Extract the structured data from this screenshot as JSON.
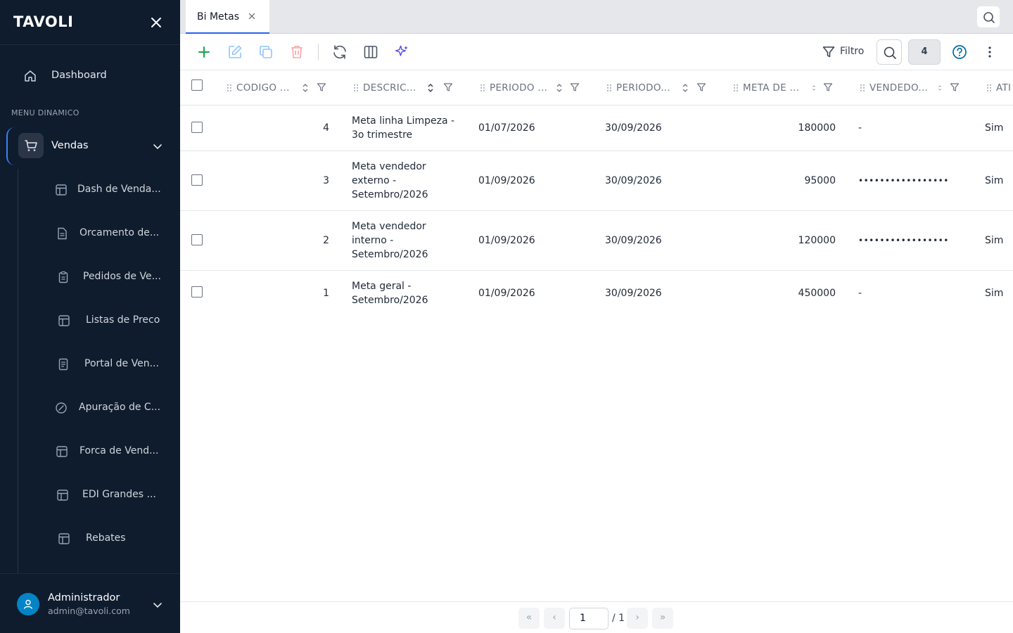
{
  "app": {
    "logo": "TAVOLI"
  },
  "sidebar": {
    "dashboard_label": "Dashboard",
    "section_title": "MENU DINAMICO",
    "vendas_label": "Vendas",
    "submenu": [
      {
        "label": "Dash de Venda...",
        "icon": "dashboard-icon"
      },
      {
        "label": "Orcamento de...",
        "icon": "document-icon"
      },
      {
        "label": "Pedidos de Ve...",
        "icon": "clipboard-icon"
      },
      {
        "label": "Listas de Preco",
        "icon": "layout-icon"
      },
      {
        "label": "Portal de Ven...",
        "icon": "document-icon"
      },
      {
        "label": "Apuração de C...",
        "icon": "gauge-icon"
      },
      {
        "label": "Forca de Vend...",
        "icon": "layout-icon"
      },
      {
        "label": "EDI Grandes ...",
        "icon": "layout-icon"
      },
      {
        "label": "Rebates",
        "icon": "layout-icon"
      }
    ],
    "user": {
      "name": "Administrador",
      "email": "admin@tavoli.com"
    }
  },
  "tabs": [
    {
      "label": "Bi Metas",
      "active": true
    }
  ],
  "toolbar": {
    "filter_label": "Filtro",
    "record_count": "4"
  },
  "table": {
    "columns": [
      "CODIGO ...",
      "DESCRIC...",
      "PERIODO ...",
      "PERIODO...",
      "META DE ...",
      "VENDEDO...",
      "ATI"
    ],
    "rows": [
      {
        "codigo": "4",
        "descricao": "Meta linha Limpeza - 3o trimestre",
        "inicio": "01/07/2026",
        "fim": "30/09/2026",
        "meta": "180000",
        "vendedor": "-",
        "ativo": "Sim"
      },
      {
        "codigo": "3",
        "descricao": "Meta vendedor externo - Setembro/2026",
        "inicio": "01/09/2026",
        "fim": "30/09/2026",
        "meta": "95000",
        "vendedor": "•••••••••••••••••",
        "ativo": "Sim"
      },
      {
        "codigo": "2",
        "descricao": "Meta vendedor interno - Setembro/2026",
        "inicio": "01/09/2026",
        "fim": "30/09/2026",
        "meta": "120000",
        "vendedor": "•••••••••••••••••",
        "ativo": "Sim"
      },
      {
        "codigo": "1",
        "descricao": "Meta geral - Setembro/2026",
        "inicio": "01/09/2026",
        "fim": "30/09/2026",
        "meta": "450000",
        "vendedor": "-",
        "ativo": "Sim"
      }
    ]
  },
  "pagination": {
    "first": "«",
    "prev": "‹",
    "next": "›",
    "last": "»",
    "current_page": "1",
    "total": "/ 1"
  },
  "colors": {
    "sidebar_bg": "#0f1c2e",
    "accent": "#2563eb",
    "add": "#16a34a",
    "delete": "#ef4444",
    "ai": "#4f46e5"
  }
}
